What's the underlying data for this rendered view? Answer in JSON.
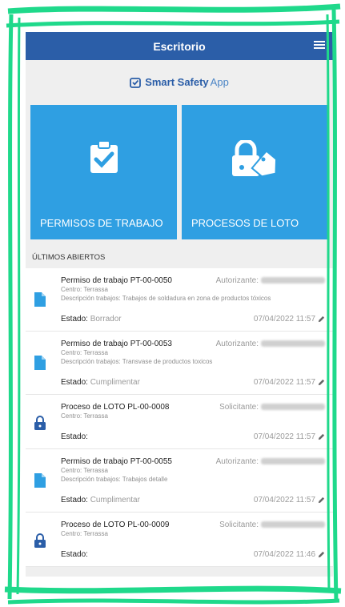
{
  "header": {
    "title": "Escritorio"
  },
  "brand": {
    "name": "Smart Safety",
    "suffix": "App"
  },
  "tiles": [
    {
      "label": "PERMISOS DE TRABAJO",
      "icon": "clipboard-check-icon"
    },
    {
      "label": "PROCESOS DE LOTO",
      "icon": "lock-tag-icon"
    }
  ],
  "section": {
    "title": "ÚLTIMOS ABIERTOS"
  },
  "items": [
    {
      "title": "Permiso de trabajo PT-00-0050",
      "role": "Autorizante:",
      "centro": "Centro: Terrassa",
      "descripcion": "Descripción trabajos: Trabajos de soldadura en zona de productos tóxicos",
      "estado_label": "Estado:",
      "estado_value": "Borrador",
      "date": "07/04/2022 11:57",
      "icon": "document-icon"
    },
    {
      "title": "Permiso de trabajo PT-00-0053",
      "role": "Autorizante:",
      "centro": "Centro: Terrassa",
      "descripcion": "Descripción trabajos: Transvase de productos toxicos",
      "estado_label": "Estado:",
      "estado_value": "Cumplimentar",
      "date": "07/04/2022 11:57",
      "icon": "document-icon"
    },
    {
      "title": "Proceso de LOTO PL-00-0008",
      "role": "Solicitante:",
      "centro": "Centro: Terrassa",
      "descripcion": "",
      "estado_label": "Estado:",
      "estado_value": "",
      "date": "07/04/2022 11:57",
      "icon": "lock-icon"
    },
    {
      "title": "Permiso de trabajo PT-00-0055",
      "role": "Autorizante:",
      "centro": "Centro: Terrassa",
      "descripcion": "Descripción trabajos: Trabajos detalle",
      "estado_label": "Estado:",
      "estado_value": "Cumplimentar",
      "date": "07/04/2022 11:57",
      "icon": "document-icon"
    },
    {
      "title": "Proceso de LOTO PL-00-0009",
      "role": "Solicitante:",
      "centro": "Centro: Terrassa",
      "descripcion": "",
      "estado_label": "Estado:",
      "estado_value": "",
      "date": "07/04/2022 11:46",
      "icon": "lock-icon"
    }
  ],
  "colors": {
    "appbar": "#2b5ea8",
    "tile": "#2f9fe2",
    "frame": "#1fd98b"
  }
}
